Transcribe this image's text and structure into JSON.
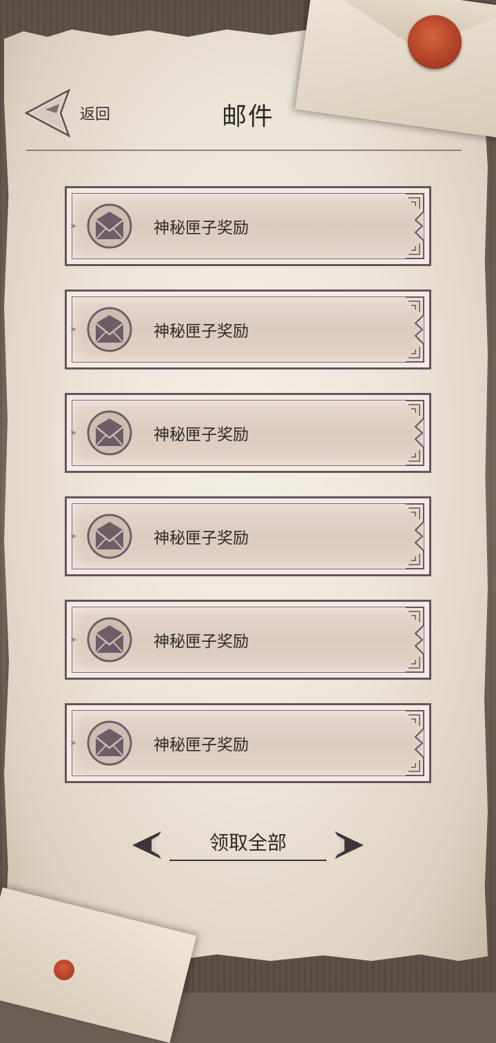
{
  "header": {
    "back_label": "返回",
    "title": "邮件"
  },
  "mail_items": [
    {
      "label": "神秘匣子奖励"
    },
    {
      "label": "神秘匣子奖励"
    },
    {
      "label": "神秘匣子奖励"
    },
    {
      "label": "神秘匣子奖励"
    },
    {
      "label": "神秘匣子奖励"
    },
    {
      "label": "神秘匣子奖励"
    }
  ],
  "footer": {
    "claim_all_label": "领取全部"
  },
  "icons": {
    "back": "back-arrow-icon",
    "mail": "envelope-icon",
    "claim_left": "arrow-left-icon",
    "claim_right": "arrow-right-icon"
  },
  "colors": {
    "frame": "#66535e",
    "item_fill": "#dccbbf",
    "text": "#2f2a29",
    "seal": "#a83a22"
  }
}
